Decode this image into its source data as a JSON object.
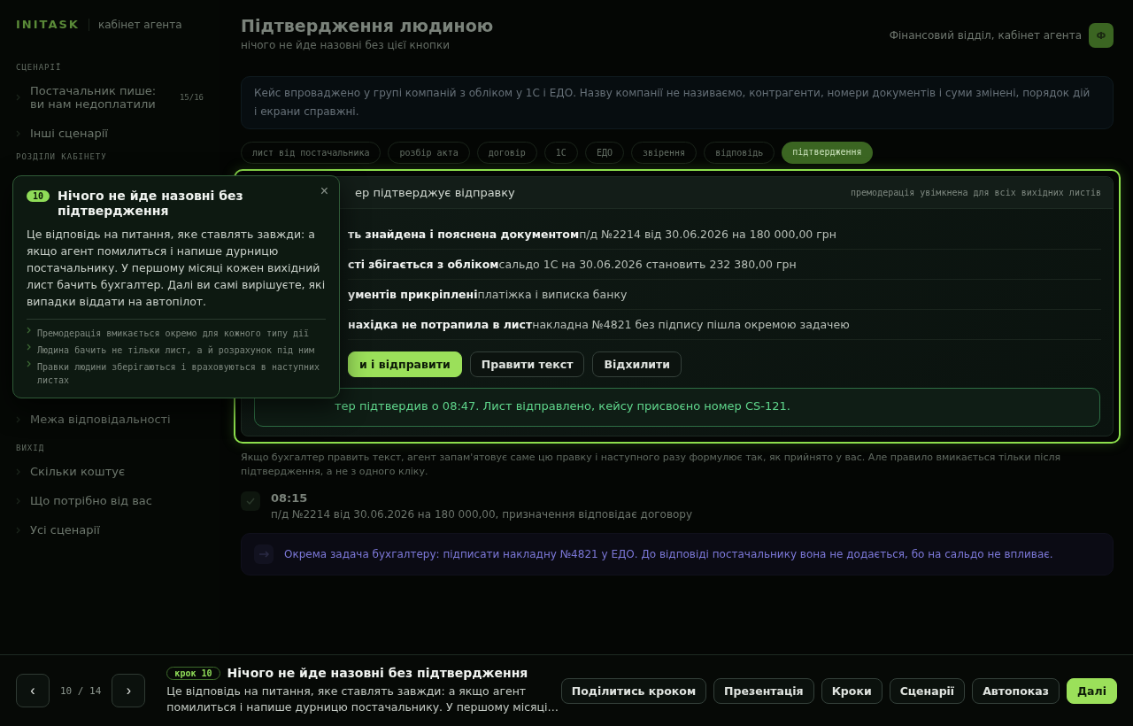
{
  "sidebar": {
    "logo": "INITASK",
    "subtitle": "кабінет агента",
    "sections": [
      {
        "title": "СЦЕНАРІЇ",
        "items": [
          {
            "label": "Постачальник пише: ви нам недоплатили",
            "count": "15/16"
          },
          {
            "label": "Інші сценарії"
          }
        ]
      },
      {
        "title": "РОЗДІЛИ КАБІНЕТУ",
        "items": [
          {
            "label": "Межа відповідальності"
          }
        ]
      },
      {
        "title": "ВИХІД",
        "items": [
          {
            "label": "Скільки коштує"
          },
          {
            "label": "Що потрібно від вас"
          },
          {
            "label": "Усі сценарії"
          }
        ]
      }
    ]
  },
  "header": {
    "title": "Підтвердження людиною",
    "subtitle": "нічого не йде назовні без цієї кнопки",
    "account": "Фінансовий відділ, кабінет агента",
    "avatar": "Ф"
  },
  "info": "Кейс впроваджено у групі компаній з обліком у 1С і ЕДО. Назву компанії не називаємо, контрагенти, номери документів і суми змінені, порядок дій і екрани справжні.",
  "tabs": [
    {
      "label": "лист від постачальника",
      "selected": false
    },
    {
      "label": "розбір акта",
      "selected": false
    },
    {
      "label": "договір",
      "selected": false
    },
    {
      "label": "1С",
      "selected": false
    },
    {
      "label": "ЕДО",
      "selected": false
    },
    {
      "label": "звірення",
      "selected": false
    },
    {
      "label": "відповідь",
      "selected": false
    },
    {
      "label": "підтвердження",
      "selected": true
    }
  ],
  "card": {
    "title": "ер підтверджує відправку",
    "meta": "премодерація увімкнена для всіх вихідних листів",
    "checks": [
      {
        "title": "ть знайдена і пояснена документом",
        "detail": "п/д №2214 від 30.06.2026 на 180 000,00 грн"
      },
      {
        "title": "сті збігається з обліком",
        "detail": "сальдо 1С на 30.06.2026 становить 232 380,00 грн"
      },
      {
        "title": "ументів прикріплені",
        "detail": "платіжка і виписка банку"
      },
      {
        "title": "нахідка не потрапила в лист",
        "detail": "накладна №4821 без підпису пішла окремою задачею"
      }
    ],
    "buttons": [
      {
        "label": "и і відправити",
        "kind": "primary"
      },
      {
        "label": "Правити текст",
        "kind": "default"
      },
      {
        "label": "Відхилити",
        "kind": "default"
      }
    ],
    "confirmation": "тер підтвердив о 08:47. Лист відправлено, кейсу присвоєно номер CS-121."
  },
  "note": "Якщо бухгалтер править текст, агент запам'ятовує саме цю правку і наступного разу формулює так, як прийнято у вас. Але правило вмикається тільки після підтвердження, а не з одного кліку.",
  "timeline": [
    {
      "time": "08:15",
      "text": "п/д №2214 від 30.06.2026 на 180 000,00, призначення відповідає договору"
    }
  ],
  "task": "Окрема задача бухгалтеру: підписати накладну №4821 у ЕДО. До відповіді постачальнику вона не додається, бо на сальдо не впливає.",
  "popover": {
    "step": "10",
    "title": "Нічого не йде назовні без підтвердження",
    "close": "×",
    "body": "Це відповідь на питання, яке ставлять завжди: а якщо агент помилиться і напише дурницю постачальнику. У першому місяці кожен вихідний лист бачить бухгалтер. Далі ви самі вирішуєте, які випадки віддати на автопілот.",
    "points": [
      "Премодерація вмикається окремо для кожного типу дії",
      "Людина бачить не тільки лист, а й розрахунок під ним",
      "Правки людини зберігаються і враховуються в наступних листах"
    ]
  },
  "footer": {
    "prev": "‹",
    "counter": "10 / 14",
    "next": "›",
    "badge": "крок 10",
    "title": "Нічого не йде назовні без підтвердження",
    "text": "Це відповідь на питання, яке ставлять завжди: а якщо агент помилиться і напише дурницю постачальнику. У першому місяці…",
    "buttons": [
      {
        "label": "Поділитись кроком",
        "kind": "default"
      },
      {
        "label": "Презентація",
        "kind": "default"
      },
      {
        "label": "Кроки",
        "kind": "default"
      },
      {
        "label": "Сценарії",
        "kind": "default"
      },
      {
        "label": "Автопоказ",
        "kind": "default"
      },
      {
        "label": "Далі",
        "kind": "primary"
      }
    ]
  }
}
